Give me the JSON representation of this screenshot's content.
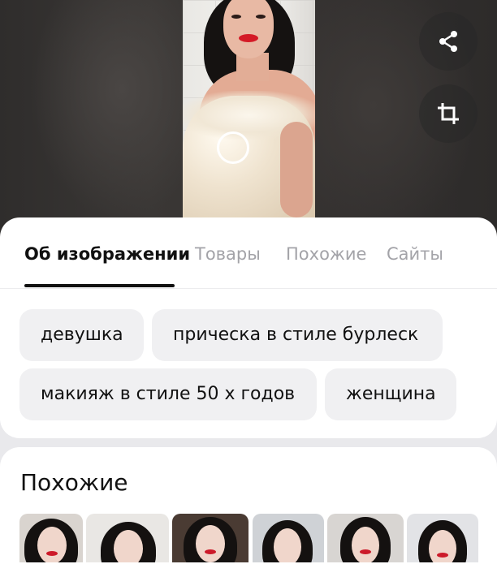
{
  "viewer": {
    "actions": [
      {
        "name": "share",
        "icon": "share-icon"
      },
      {
        "name": "crop",
        "icon": "crop-icon"
      }
    ],
    "lens_icon": "lens-circle-icon"
  },
  "tabs": [
    {
      "label": "Об изображении",
      "active": true
    },
    {
      "label": "Товары",
      "active": false
    },
    {
      "label": "Похожие",
      "active": false
    },
    {
      "label": "Сайты",
      "active": false
    }
  ],
  "tags": [
    "девушка",
    "прическа в стиле бурлеск",
    "макияж в стиле 50 х годов",
    "женщина"
  ],
  "similar": {
    "title": "Похожие",
    "thumbnails_count": 6
  },
  "colors": {
    "accent": "#111111",
    "chip_bg": "#f0f0f2",
    "tab_inactive": "#a3a3a8",
    "page_bg": "#e9e9ec"
  }
}
